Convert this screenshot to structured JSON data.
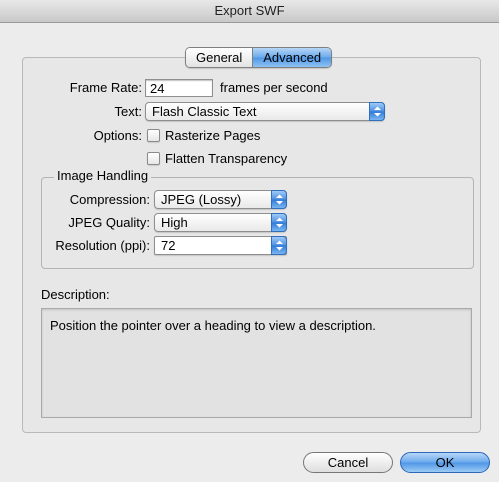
{
  "window": {
    "title": "Export SWF"
  },
  "tabs": [
    {
      "label": "General",
      "selected": false
    },
    {
      "label": "Advanced",
      "selected": true
    }
  ],
  "frame_rate": {
    "label": "Frame Rate:",
    "value": "24",
    "unit": "frames per second"
  },
  "text": {
    "label": "Text:",
    "value": "Flash Classic Text"
  },
  "options": {
    "label": "Options:",
    "rasterize_pages": {
      "label": "Rasterize Pages",
      "checked": false
    },
    "flatten_transparency": {
      "label": "Flatten Transparency",
      "checked": false
    }
  },
  "image_handling": {
    "title": "Image Handling",
    "compression": {
      "label": "Compression:",
      "value": "JPEG (Lossy)"
    },
    "jpeg_quality": {
      "label": "JPEG Quality:",
      "value": "High"
    },
    "resolution": {
      "label": "Resolution (ppi):",
      "value": "72"
    }
  },
  "description": {
    "label": "Description:",
    "text": "Position the pointer over a heading to view a description."
  },
  "buttons": {
    "cancel": "Cancel",
    "ok": "OK"
  },
  "colors": {
    "accent": "#4e97e6",
    "window_bg": "#ececec"
  },
  "icons": {
    "popup_arrows": "up-down-arrows-icon"
  }
}
